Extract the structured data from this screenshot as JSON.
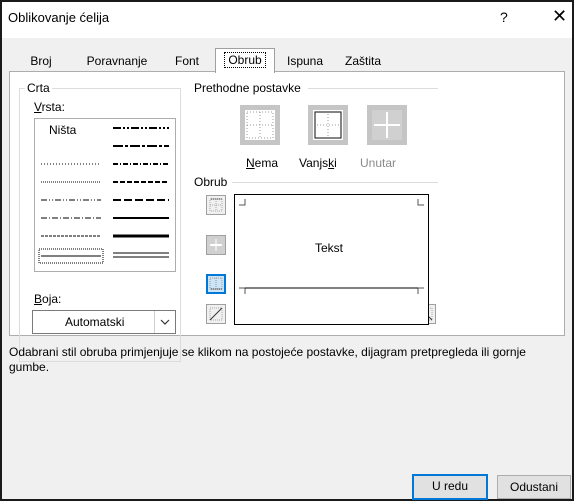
{
  "window": {
    "title": "Oblikovanje ćelija",
    "help_glyph": "?",
    "close_glyph": "✕"
  },
  "tabs": [
    {
      "label": "Broj"
    },
    {
      "label": "Poravnanje"
    },
    {
      "label": "Font"
    },
    {
      "label": "Obrub",
      "active": true
    },
    {
      "label": "Ispuna"
    },
    {
      "label": "Zaštita"
    }
  ],
  "line": {
    "group_title": "Crta",
    "style_label": "Vrsta:",
    "style_none": "Ništa",
    "color_label": "Boja:",
    "color_value": "Automatski"
  },
  "presets": {
    "title": "Prethodne postavke",
    "items": [
      {
        "label": "Nema",
        "enabled": true
      },
      {
        "label": "Vanjski",
        "enabled": true
      },
      {
        "label": "Unutar",
        "enabled": false
      }
    ]
  },
  "border": {
    "title": "Obrub",
    "preview_text": "Tekst"
  },
  "description": "Odabrani stil obruba primjenjuje se klikom na postojeće postavke, dijagram pretpregleda ili gornje gumbe.",
  "buttons": {
    "ok": "U redu",
    "cancel": "Odustani"
  },
  "colors": {
    "accent": "#0078d7",
    "disabled_text": "#8a8a8a",
    "dialog_bg": "#f0f0f0"
  }
}
